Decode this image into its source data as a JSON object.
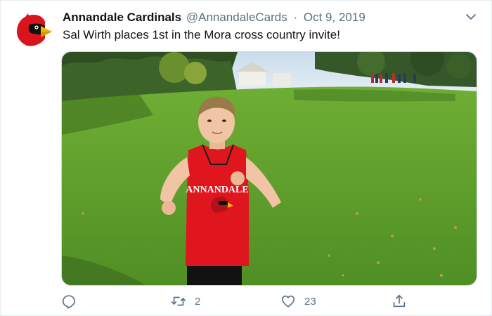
{
  "tweet": {
    "author": {
      "display_name": "Annandale Cardinals",
      "handle": "@AnnandaleCards",
      "avatar_icon": "cardinal-logo-icon"
    },
    "separator": "·",
    "date": "Oct 9, 2019",
    "text": "Sal Wirth places 1st in the Mora cross country invite!",
    "media": {
      "shirt_text": "ANNANDALE",
      "icon": "runner-photo"
    },
    "actions": {
      "reply": {
        "icon": "reply-icon",
        "count": ""
      },
      "retweet": {
        "icon": "retweet-icon",
        "count": "2"
      },
      "like": {
        "icon": "heart-icon",
        "count": "23"
      },
      "share": {
        "icon": "share-icon",
        "count": ""
      }
    },
    "menu_icon": "chevron-down-icon"
  },
  "colors": {
    "text_primary": "#0f1419",
    "text_secondary": "#5b7083",
    "cardinal_red": "#e0161f",
    "beak_yellow": "#f5b400",
    "grass": "#5f9f2e",
    "border": "#e6ecf0"
  }
}
